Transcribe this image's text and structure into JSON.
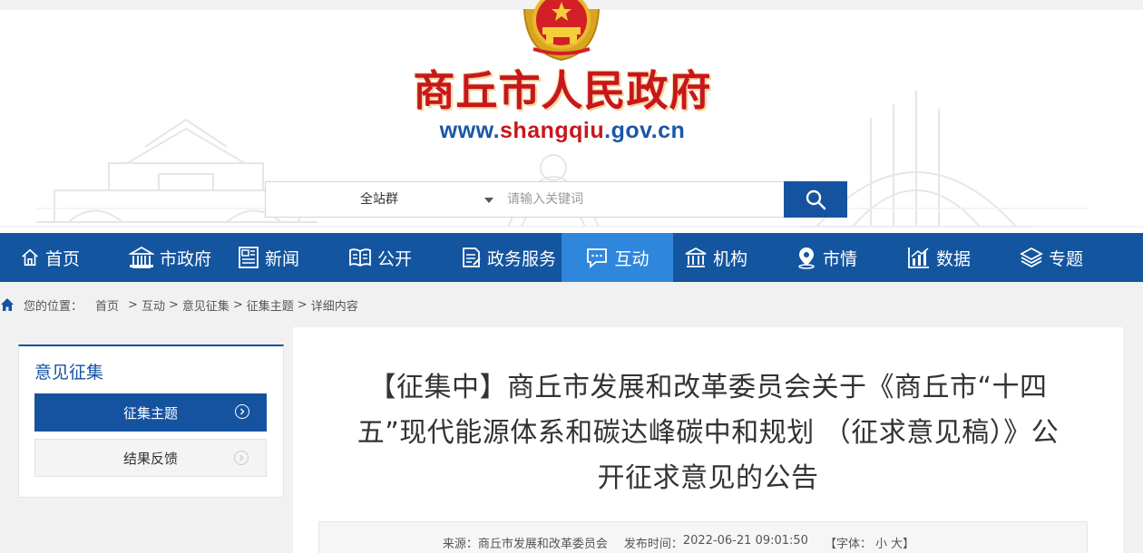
{
  "header": {
    "site_title": "商丘市人民政府",
    "site_url_prefix": "www.",
    "site_url_domain": "shangqiu",
    "site_url_suffix": ".gov.cn",
    "colors": {
      "title_red": "#c8161d",
      "url_blue": "#1a57a6",
      "nav_blue": "#13559f",
      "nav_active": "#2f87dd"
    }
  },
  "search": {
    "scope_selected": "全站群",
    "placeholder": "请输入关键词",
    "button_icon": "search-icon"
  },
  "nav": {
    "items": [
      {
        "label": "首页",
        "icon": "home-icon"
      },
      {
        "label": "市政府",
        "icon": "government-building-icon"
      },
      {
        "label": "新闻",
        "icon": "newspaper-icon"
      },
      {
        "label": "公开",
        "icon": "open-book-icon"
      },
      {
        "label": "政务服务",
        "icon": "service-document-icon"
      },
      {
        "label": "互动",
        "icon": "chat-bubble-icon",
        "active": true
      },
      {
        "label": "机构",
        "icon": "institution-icon"
      },
      {
        "label": "市情",
        "icon": "location-pin-icon"
      },
      {
        "label": "数据",
        "icon": "bar-chart-icon"
      },
      {
        "label": "专题",
        "icon": "layers-icon"
      }
    ]
  },
  "breadcrumb": {
    "label": "您的位置：",
    "items": [
      "首页",
      "互动",
      "意见征集",
      "征集主题",
      "详细内容"
    ],
    "separator": ">"
  },
  "sidebar": {
    "title": "意见征集",
    "links": [
      {
        "label": "征集主题",
        "active": true
      },
      {
        "label": "结果反馈",
        "active": false
      }
    ]
  },
  "article": {
    "title": "【征集中】商丘市发展和改革委员会关于《商丘市“十四五”现代能源体系和碳达峰碳中和规划 （征求意见稿）》公开征求意见的公告",
    "source_label": "来源：",
    "source": "商丘市发展和改革委员会",
    "publish_label": "发布时间：",
    "publish_time": "2022-06-21 09:01:50",
    "font_label": "【字体：",
    "font_small": "小",
    "font_large": "大",
    "font_close": "】"
  }
}
